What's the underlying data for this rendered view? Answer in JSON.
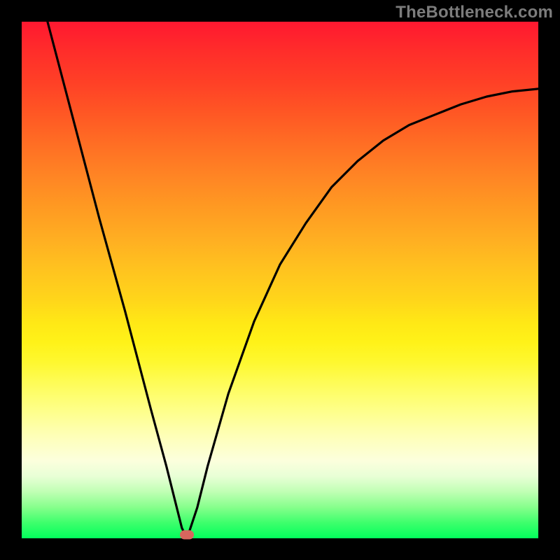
{
  "attribution": "TheBottleneck.com",
  "colors": {
    "frame": "#000000",
    "gradient_top": "#ff1830",
    "gradient_bottom": "#02ff5c",
    "curve": "#000000",
    "marker": "#d8665e",
    "attribution_text": "#7c7c7c"
  },
  "chart_data": {
    "type": "line",
    "title": "",
    "xlabel": "",
    "ylabel": "",
    "xlim": [
      0,
      100
    ],
    "ylim": [
      0,
      100
    ],
    "grid": false,
    "series": [
      {
        "name": "bottleneck-curve",
        "x": [
          5,
          10,
          15,
          20,
          25,
          28,
          30,
          31,
          32,
          34,
          36,
          40,
          45,
          50,
          55,
          60,
          65,
          70,
          75,
          80,
          85,
          90,
          95,
          100
        ],
        "y": [
          100,
          81,
          62,
          44,
          25,
          14,
          6,
          2,
          0,
          6,
          14,
          28,
          42,
          53,
          61,
          68,
          73,
          77,
          80,
          82,
          84,
          85.5,
          86.5,
          87
        ]
      }
    ],
    "annotations": [
      {
        "name": "optimal-marker",
        "x": 32,
        "y": 0.5,
        "shape": "pill",
        "color": "#d8665e"
      }
    ],
    "background": {
      "type": "vertical-gradient",
      "stops": [
        {
          "pos": 0,
          "color": "#ff1830"
        },
        {
          "pos": 50,
          "color": "#ffc31f"
        },
        {
          "pos": 75,
          "color": "#feff87"
        },
        {
          "pos": 100,
          "color": "#02ff5c"
        }
      ]
    }
  }
}
